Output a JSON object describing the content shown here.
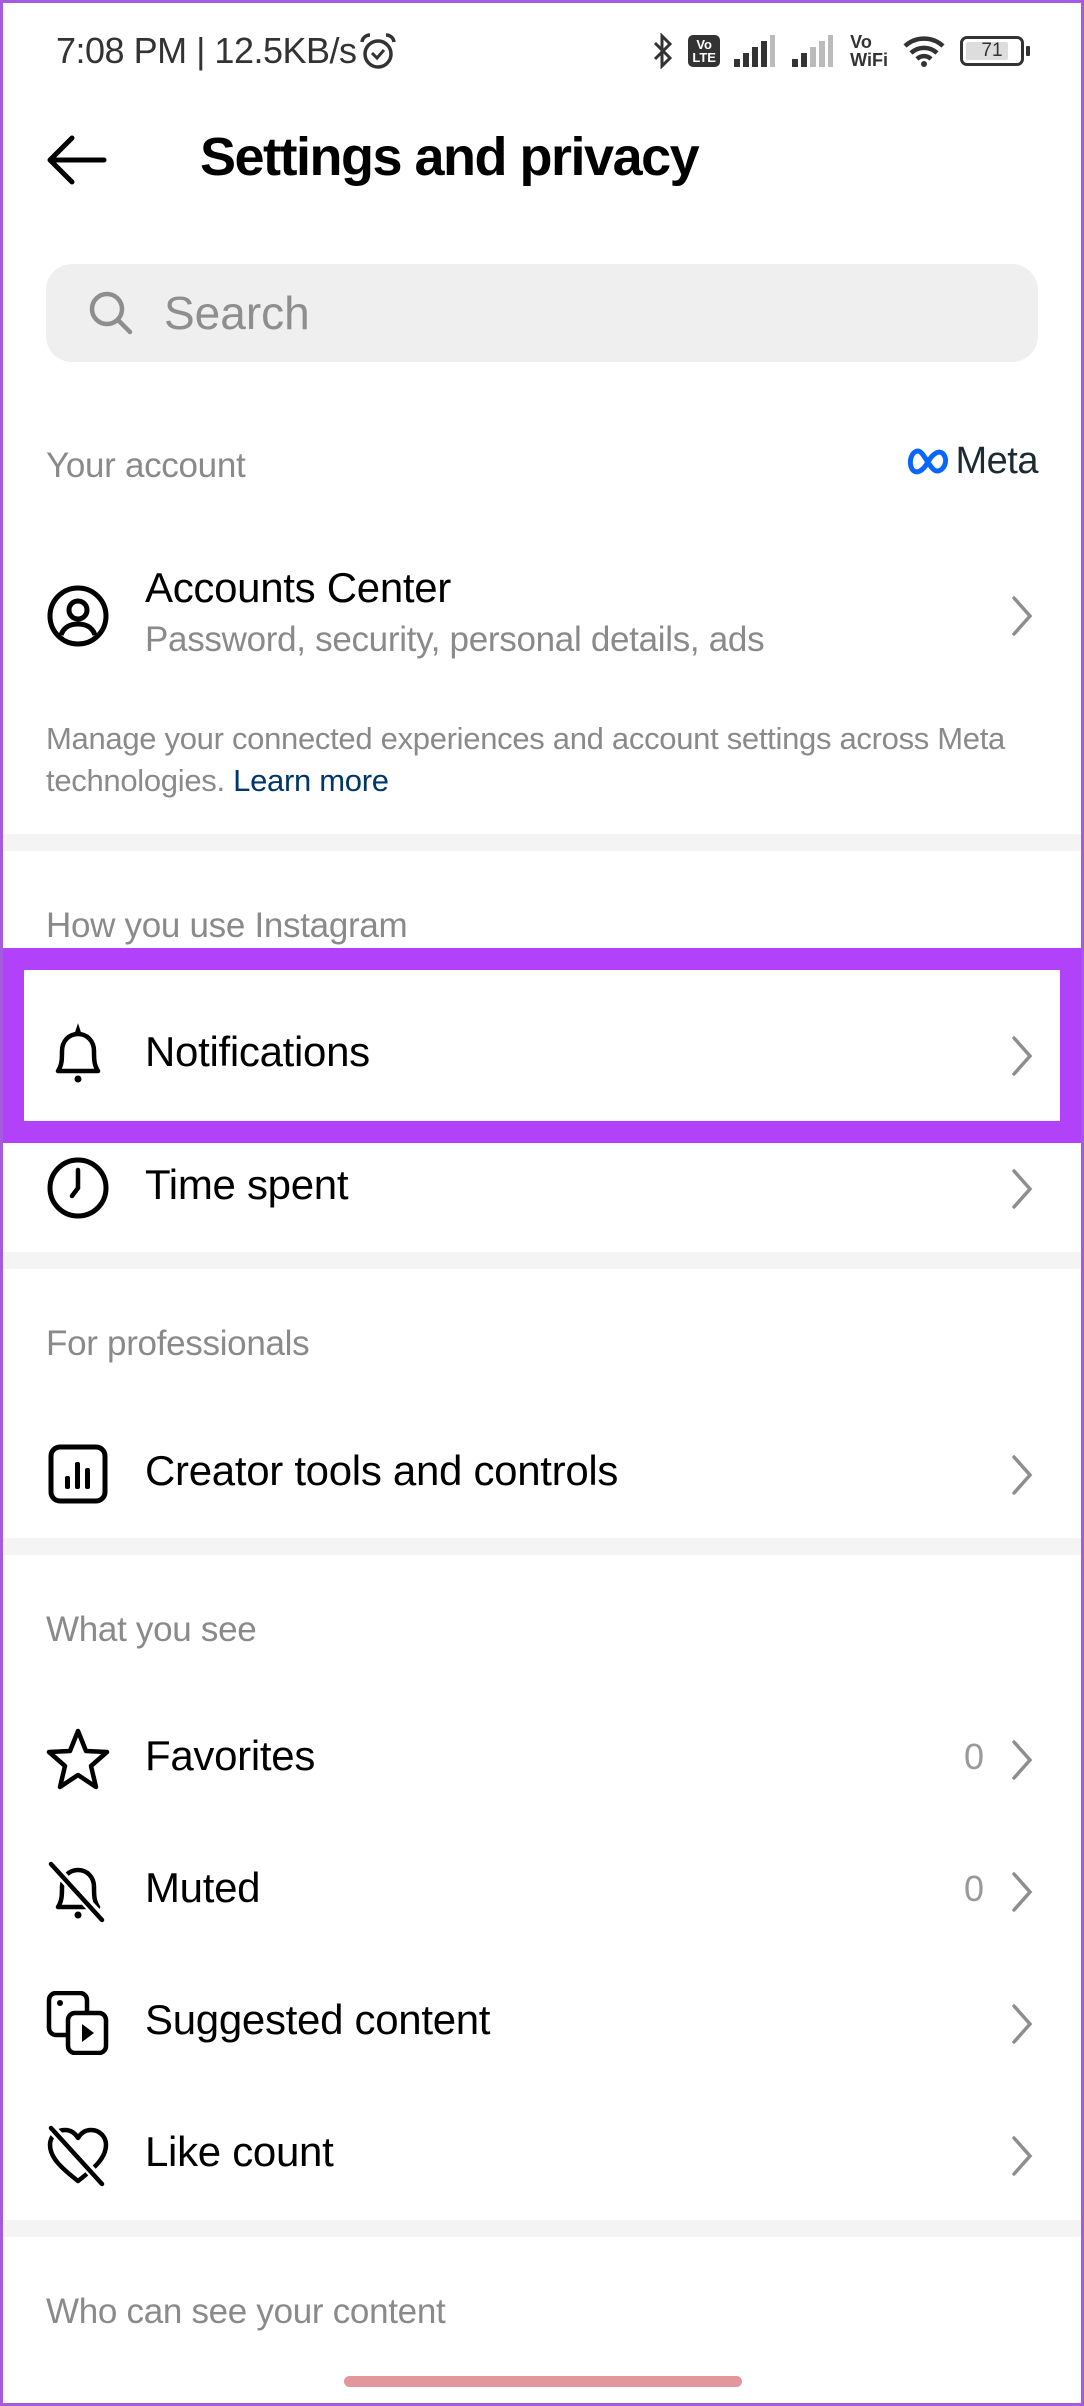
{
  "status_bar": {
    "time": "7:08 PM | 12.5KB/s",
    "icons": [
      "alarm-icon",
      "bluetooth-icon",
      "volte-icon",
      "signal-1-icon",
      "signal-2-icon",
      "vowifi-icon",
      "wifi-icon",
      "battery-icon"
    ],
    "volte_line1": "Vo",
    "volte_line2": "LTE",
    "vowifi_line1": "Vo",
    "vowifi_line2": "WiFi",
    "battery_level": "71"
  },
  "header": {
    "back_icon": "arrow-left-icon",
    "title": "Settings and privacy"
  },
  "search": {
    "placeholder": "Search",
    "value": "",
    "icon": "search-icon"
  },
  "sections": {
    "your_account": {
      "label": "Your account",
      "brand": "Meta",
      "brand_color": "#0866ff",
      "accounts_center": {
        "icon": "user-circle-icon",
        "title": "Accounts Center",
        "subtitle": "Password, security, personal details, ads"
      },
      "description": "Manage your connected experiences and account settings across Meta technologies.",
      "learn_more": "Learn more"
    },
    "how_you_use": {
      "label": "How you use Instagram",
      "items": [
        {
          "label": "Notifications",
          "icon": "bell-icon",
          "highlighted": true
        },
        {
          "label": "Time spent",
          "icon": "clock-icon"
        }
      ]
    },
    "for_professionals": {
      "label": "For professionals",
      "items": [
        {
          "label": "Creator tools and controls",
          "icon": "chart-bars-icon"
        }
      ]
    },
    "what_you_see": {
      "label": "What you see",
      "items": [
        {
          "label": "Favorites",
          "icon": "star-icon",
          "count": "0"
        },
        {
          "label": "Muted",
          "icon": "bell-off-icon",
          "count": "0"
        },
        {
          "label": "Suggested content",
          "icon": "media-play-icon"
        },
        {
          "label": "Like count",
          "icon": "heart-off-icon"
        }
      ]
    },
    "who_can_see": {
      "label": "Who can see your content"
    }
  },
  "colors": {
    "highlight": "#b142fa",
    "link": "#00376b",
    "secondary_text": "#8a8a8a",
    "home_indicator": "#e3969c"
  }
}
